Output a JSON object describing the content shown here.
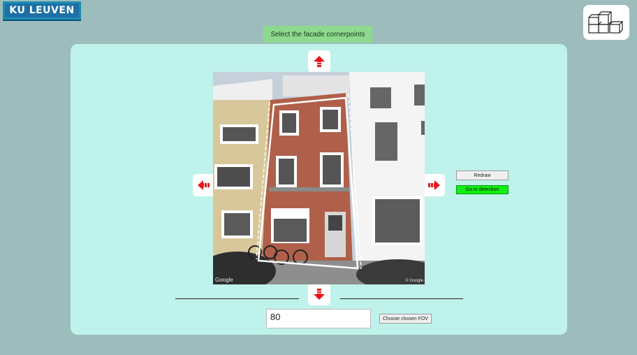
{
  "header": {
    "logo_text": "KU LEUVEN"
  },
  "instruction": {
    "text": "Select the facade cornerpoints"
  },
  "controls": {
    "redraw_label": "Redraw",
    "go_detection_label": "Go to detection",
    "fov_value": "80",
    "fov_button_label": "Choose chosen FOV"
  },
  "image": {
    "watermark_left": "Google",
    "watermark_right": "© Google"
  },
  "icons": {
    "up": "arrow-up-icon",
    "down": "arrow-down-icon",
    "left": "arrow-left-icon",
    "right": "arrow-right-icon",
    "app": "stacked-boxes-icon"
  },
  "colors": {
    "panel": "#bff2ea",
    "background": "#9dbcbc",
    "instruction": "#8dd98d",
    "go_button": "#11ee11",
    "arrow": "#e8161b"
  }
}
